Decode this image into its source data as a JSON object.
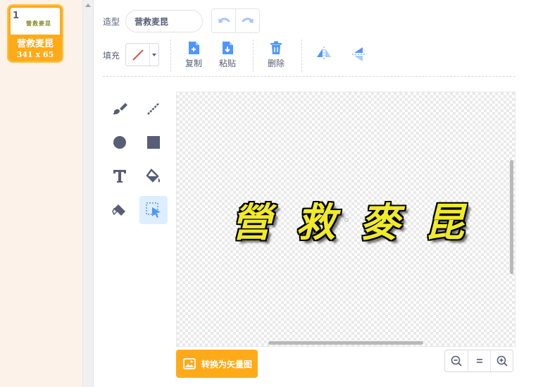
{
  "costume": {
    "number": "1",
    "thumb_text": "營救麥昆",
    "name": "营救麦昆",
    "size": "341 x 65"
  },
  "toolbar": {
    "costume_label": "造型",
    "costume_name": "营救麦昆",
    "fill_label": "填充",
    "copy_label": "复制",
    "paste_label": "粘贴",
    "delete_label": "删除"
  },
  "canvas": {
    "chars": [
      "營",
      "救",
      "麥",
      "昆"
    ]
  },
  "bottom": {
    "convert_label": "转换为矢量图"
  },
  "colors": {
    "accent": "#ffab19",
    "blue": "#4c97ff",
    "text": "#575e75",
    "fill_none": "#e5533d"
  },
  "icons": [
    "undo-icon",
    "redo-icon",
    "copy-icon",
    "paste-icon",
    "delete-icon",
    "flip-horizontal-icon",
    "flip-vertical-icon",
    "brush-icon",
    "line-icon",
    "circle-icon",
    "rectangle-icon",
    "text-icon",
    "fill-icon",
    "eraser-icon",
    "select-icon",
    "zoom-out-icon",
    "zoom-reset-icon",
    "zoom-in-icon",
    "image-icon"
  ]
}
